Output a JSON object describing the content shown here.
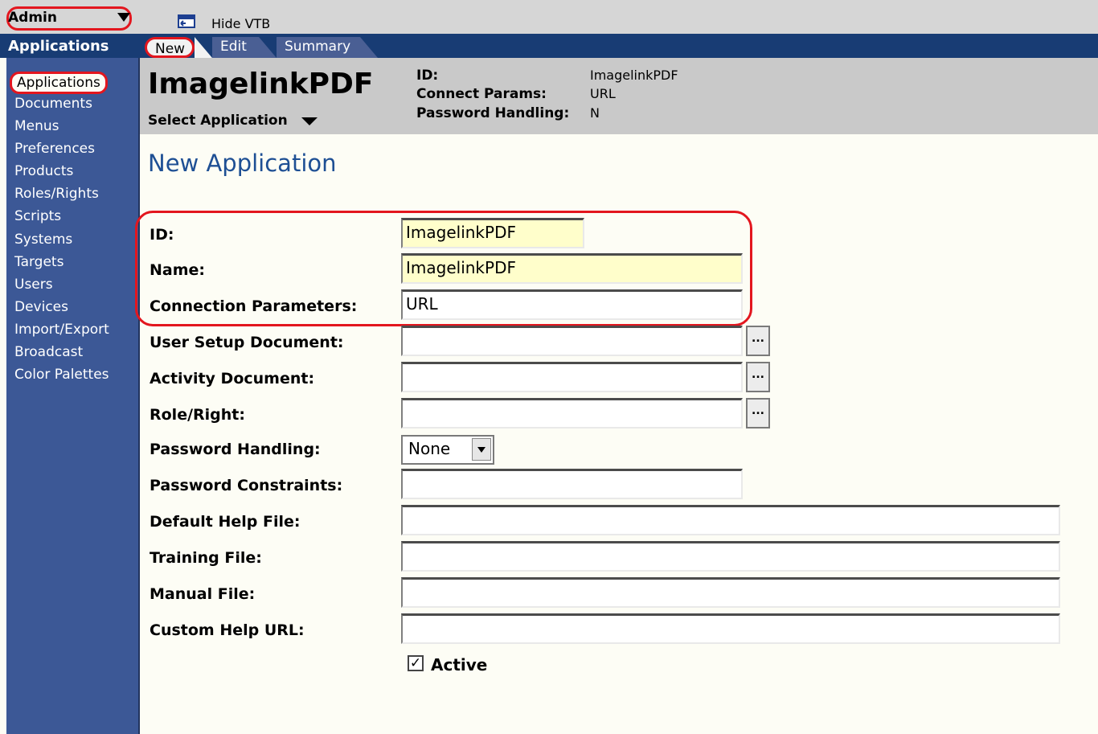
{
  "toolbar": {
    "admin_label": "Admin",
    "vtb_label": "Hide VTB"
  },
  "sidebar": {
    "title": "Applications",
    "items": [
      "Applications",
      "Documents",
      "Menus",
      "Preferences",
      "Products",
      "Roles/Rights",
      "Scripts",
      "Systems",
      "Targets",
      "Users",
      "Devices",
      "Import/Export",
      "Broadcast",
      "Color Palettes"
    ]
  },
  "tabs": {
    "new": "New",
    "edit": "Edit",
    "summary": "Summary"
  },
  "header": {
    "app_name": "ImagelinkPDF",
    "select_application": "Select Application",
    "id_key": "ID:",
    "id_value": "ImagelinkPDF",
    "connect_key": "Connect Params:",
    "connect_value": "URL",
    "password_key": "Password Handling:",
    "password_value": "N"
  },
  "form": {
    "title": "New Application",
    "id_label": "ID:",
    "id_value": "ImagelinkPDF",
    "name_label": "Name:",
    "name_value": "ImagelinkPDF",
    "conn_label": "Connection Parameters:",
    "conn_value": "URL",
    "user_setup_label": "User Setup Document:",
    "activity_label": "Activity Document:",
    "role_label": "Role/Right:",
    "pw_handling_label": "Password Handling:",
    "pw_handling_value": "None",
    "pw_constraints_label": "Password Constraints:",
    "help_label": "Default Help File:",
    "training_label": "Training File:",
    "manual_label": "Manual File:",
    "custom_help_label": "Custom Help URL:",
    "browse_label": "...",
    "active_label": "Active",
    "active_checked": true
  },
  "colors": {
    "highlight": "#e3161e",
    "nav_bg": "#3c5896",
    "tabbar_bg": "#183c74",
    "title_blue": "#1e4f94"
  }
}
